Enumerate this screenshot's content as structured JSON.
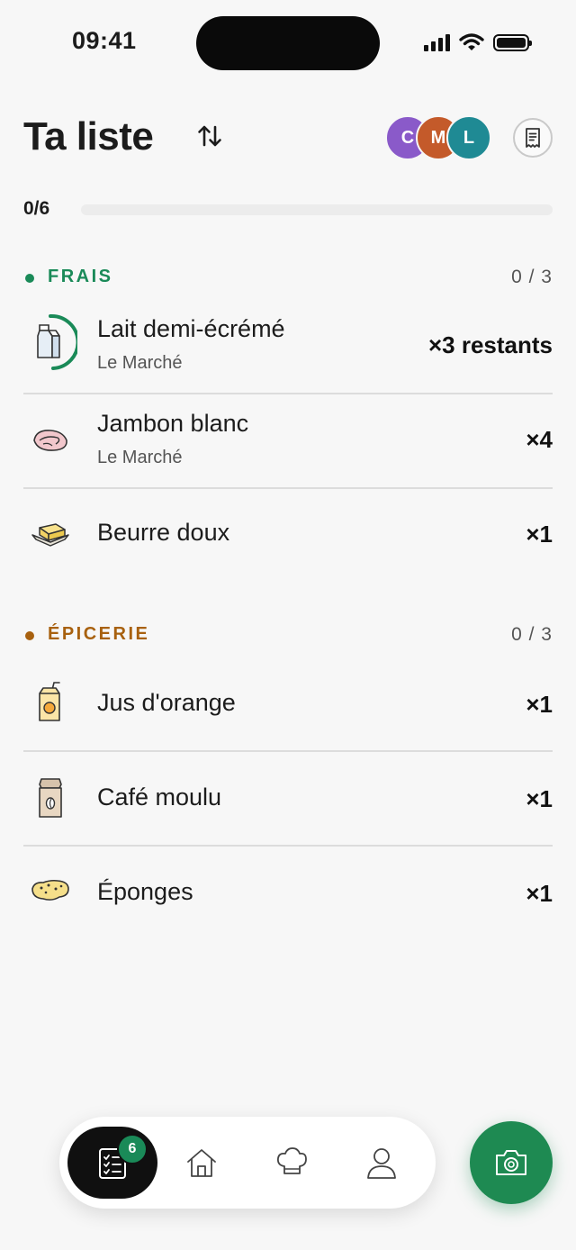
{
  "status_bar": {
    "time": "09:41"
  },
  "header": {
    "title": "Ta liste",
    "sort_icon": "sort-arrows-icon",
    "avatars": [
      {
        "initial": "C",
        "color": "#8a5ac9"
      },
      {
        "initial": "M",
        "color": "#c45a2a"
      },
      {
        "initial": "L",
        "color": "#1f8a94"
      }
    ],
    "receipt_icon": "receipt-icon"
  },
  "progress": {
    "label": "0/6",
    "done": 0,
    "total": 6
  },
  "sections": [
    {
      "title": "FRAIS",
      "count": "0 / 3",
      "color": "#1a8a58",
      "items": [
        {
          "name": "Lait demi-écrémé",
          "store": "Le Marché",
          "qty": "×3 restants",
          "icon": "milk-carton-icon"
        },
        {
          "name": "Jambon blanc",
          "store": "Le Marché",
          "qty": "×4",
          "icon": "ham-icon"
        },
        {
          "name": "Beurre doux",
          "store": "",
          "qty": "×1",
          "icon": "butter-icon"
        }
      ]
    },
    {
      "title": "ÉPICERIE",
      "count": "0 / 3",
      "color": "#a8610f",
      "items": [
        {
          "name": "Jus d'orange",
          "store": "",
          "qty": "×1",
          "icon": "juice-box-icon"
        },
        {
          "name": "Café moulu",
          "store": "",
          "qty": "×1",
          "icon": "coffee-bag-icon"
        },
        {
          "name": "Éponges",
          "store": "",
          "qty": "×1",
          "icon": "sponge-icon"
        }
      ]
    }
  ],
  "nav": {
    "badge": "6",
    "items": [
      "list-icon",
      "home-icon",
      "chef-hat-icon",
      "profile-icon"
    ]
  },
  "fab": {
    "icon": "camera-icon",
    "color": "#1e8a52"
  }
}
